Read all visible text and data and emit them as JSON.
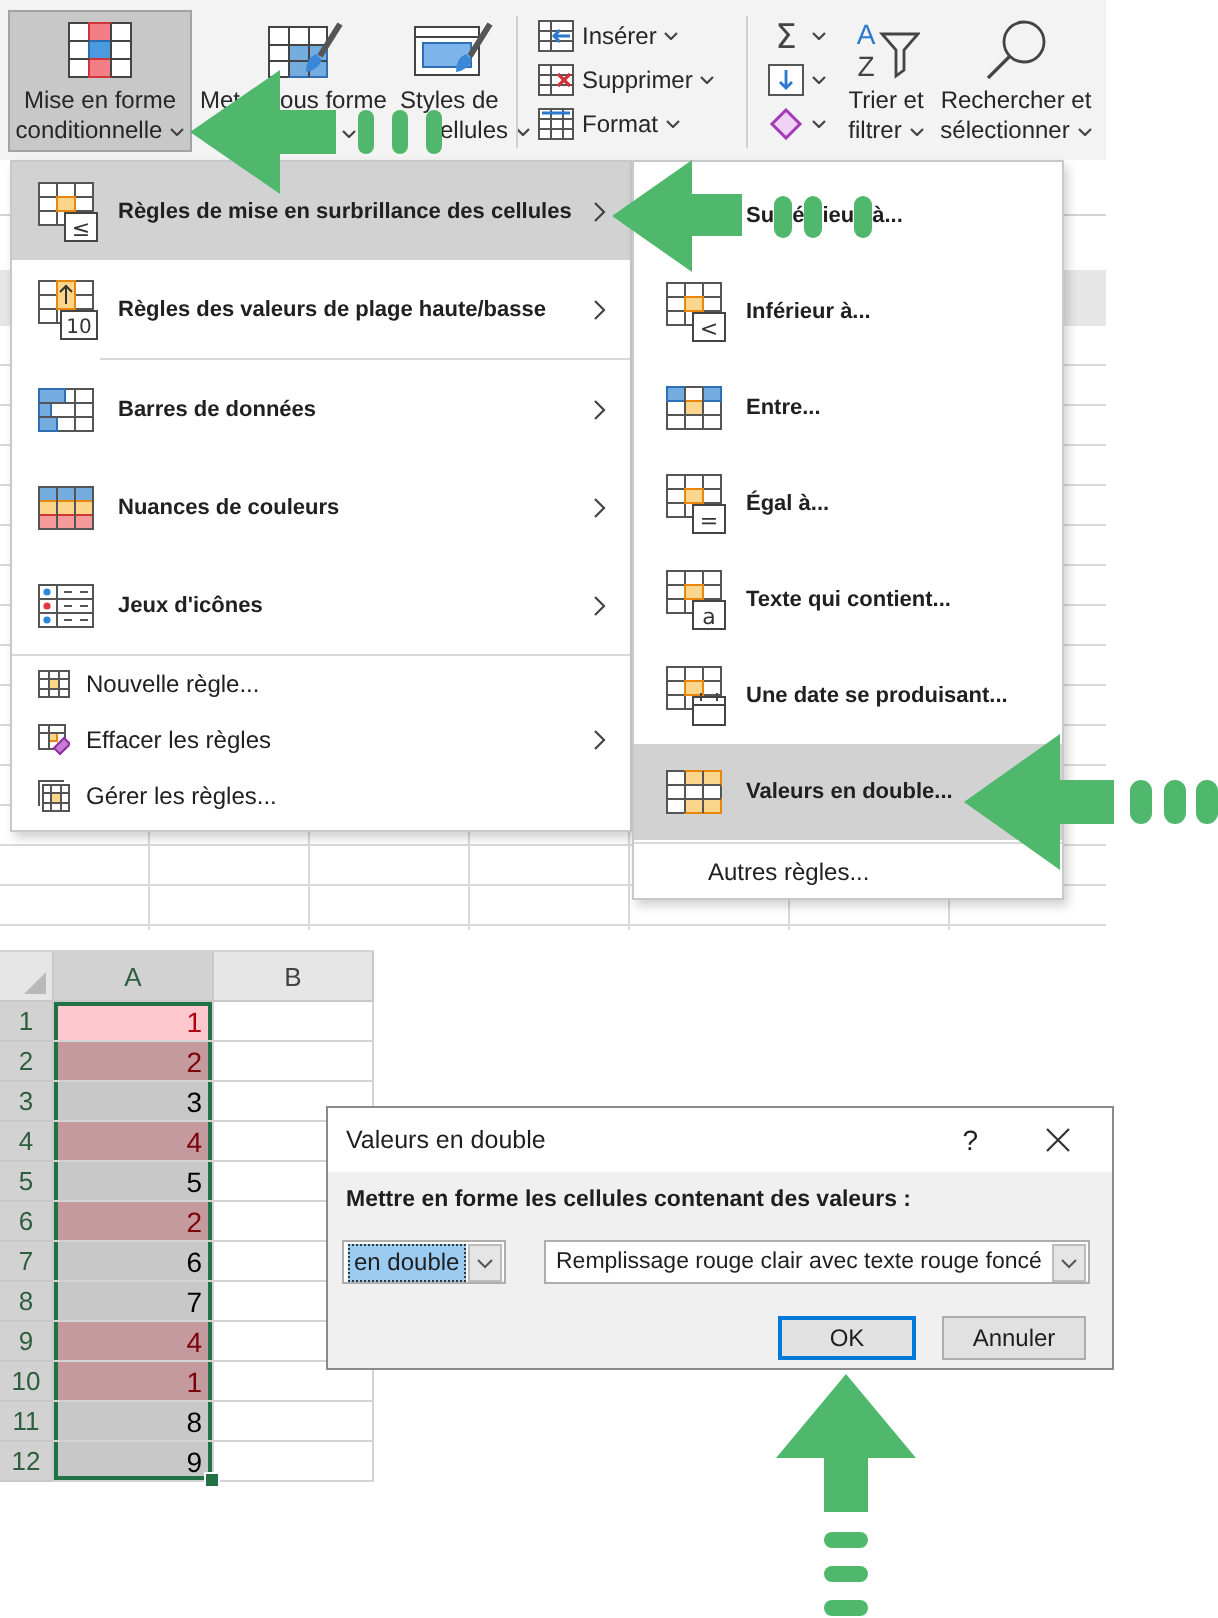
{
  "ribbon": {
    "styles": [
      {
        "lines": [
          "Mise en forme",
          "conditionnelle"
        ],
        "dropdown": true,
        "selected": true
      },
      {
        "fragments": [
          "Met",
          "ous forme"
        ],
        "dropdown": true,
        "selected": false
      },
      {
        "lines": [
          "Styles de",
          "ellules"
        ],
        "dropdown": true,
        "selected": false
      }
    ],
    "cells": [
      {
        "label": "Insérer",
        "dropdown": true
      },
      {
        "label": "Supprimer",
        "dropdown": true
      },
      {
        "label": "Format",
        "dropdown": true
      }
    ],
    "editing_small": [
      {
        "icon_text": "Σ",
        "dropdown": true
      },
      {
        "dropdown": true
      },
      {
        "dropdown": true
      }
    ],
    "editing_large": [
      {
        "lines": [
          "Trier et",
          "filtrer"
        ],
        "icon_text": [
          "A",
          "Z"
        ],
        "dropdown": true
      },
      {
        "lines": [
          "Rechercher et",
          "sélectionner"
        ],
        "dropdown": true
      }
    ]
  },
  "conditional_menu": {
    "sections": [
      {
        "kind": "large",
        "items": [
          {
            "label": "Règles de mise en surbrillance des cellules",
            "icon_text": "≤",
            "submenu": true,
            "highlighted": true
          },
          {
            "label": "Règles des valeurs de plage haute/basse",
            "icon_text": "10",
            "submenu": true,
            "highlighted": false
          }
        ]
      },
      {
        "kind": "large",
        "items": [
          {
            "label": "Barres de données",
            "submenu": true,
            "highlighted": false
          },
          {
            "label": "Nuances de couleurs",
            "submenu": true,
            "highlighted": false
          },
          {
            "label": "Jeux d'icônes",
            "submenu": true,
            "highlighted": false
          }
        ]
      },
      {
        "kind": "small",
        "items": [
          {
            "label": "Nouvelle règle...",
            "submenu": false,
            "highlighted": false
          },
          {
            "label": "Effacer les règles",
            "submenu": true,
            "highlighted": false
          },
          {
            "label": "Gérer les règles...",
            "submenu": false,
            "highlighted": false
          }
        ]
      }
    ]
  },
  "highlight_submenu": {
    "items": [
      {
        "label_fragments": [
          "Su",
          "é",
          "ieu",
          "à..."
        ],
        "highlighted": false
      },
      {
        "label": "Inférieur à...",
        "icon_text": "<",
        "highlighted": false
      },
      {
        "label": "Entre...",
        "highlighted": false
      },
      {
        "label": "Égal à...",
        "icon_text": "=",
        "highlighted": false
      },
      {
        "label": "Texte qui contient...",
        "icon_text": "a",
        "highlighted": false
      },
      {
        "label": "Une date se produisant...",
        "highlighted": false
      },
      {
        "label": "Valeurs en double...",
        "highlighted": true
      }
    ],
    "footer": "Autres règles..."
  },
  "sheet": {
    "columns": [
      {
        "label": "A",
        "selected": true
      },
      {
        "label": "B",
        "selected": false
      }
    ],
    "rows": [
      {
        "number": "1",
        "value": "1",
        "duplicate": true,
        "active": true,
        "selected": true
      },
      {
        "number": "2",
        "value": "2",
        "duplicate": true,
        "active": false,
        "selected": true
      },
      {
        "number": "3",
        "value": "3",
        "duplicate": false,
        "active": false,
        "selected": true
      },
      {
        "number": "4",
        "value": "4",
        "duplicate": true,
        "active": false,
        "selected": true
      },
      {
        "number": "5",
        "value": "5",
        "duplicate": false,
        "active": false,
        "selected": true
      },
      {
        "number": "6",
        "value": "2",
        "duplicate": true,
        "active": false,
        "selected": true
      },
      {
        "number": "7",
        "value": "6",
        "duplicate": false,
        "active": false,
        "selected": true
      },
      {
        "number": "8",
        "value": "7",
        "duplicate": false,
        "active": false,
        "selected": true
      },
      {
        "number": "9",
        "value": "4",
        "duplicate": true,
        "active": false,
        "selected": true
      },
      {
        "number": "10",
        "value": "1",
        "duplicate": true,
        "active": false,
        "selected": true
      },
      {
        "number": "11",
        "value": "8",
        "duplicate": false,
        "active": false,
        "selected": true
      },
      {
        "number": "12",
        "value": "9",
        "duplicate": false,
        "active": false,
        "selected": true
      }
    ]
  },
  "dialog": {
    "title": "Valeurs en double",
    "help": "?",
    "prompt": "Mettre en forme les cellules contenant des valeurs :",
    "condition": {
      "value": "en double",
      "focused": true
    },
    "format": {
      "value": "Remplissage rouge clair avec texte rouge foncé",
      "focused": false
    },
    "buttons": [
      {
        "label": "OK",
        "default": true
      },
      {
        "label": "Annuler",
        "default": false
      }
    ]
  }
}
